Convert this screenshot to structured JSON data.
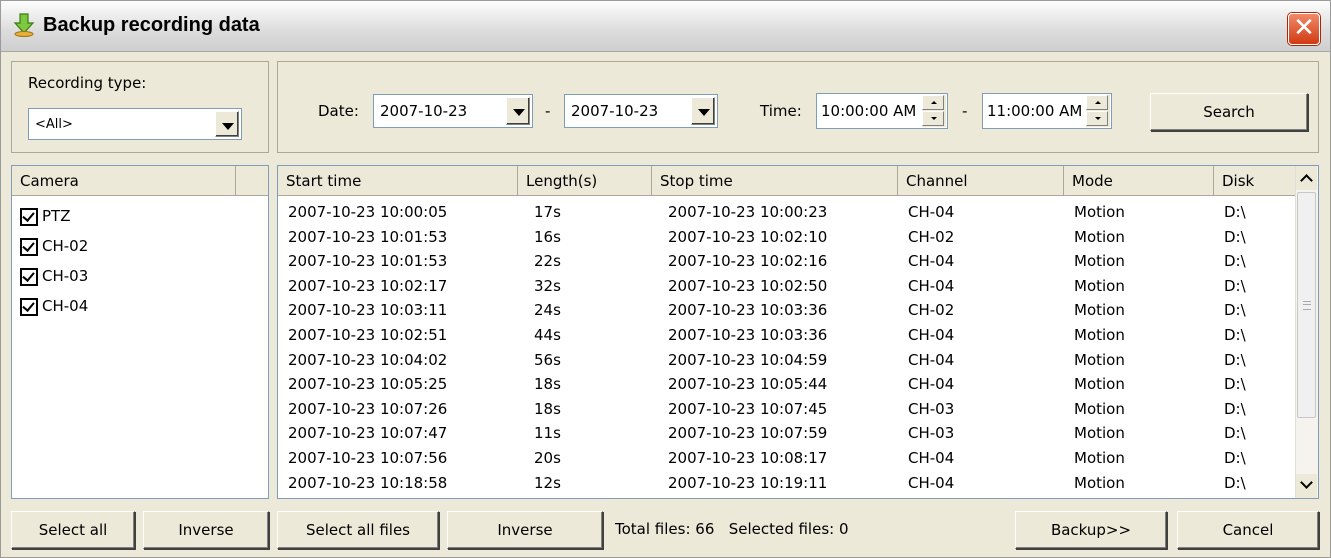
{
  "window": {
    "title": "Backup recording data",
    "close_glyph": "✕"
  },
  "filter": {
    "recording_type_label": "Recording type:",
    "recording_type_value": "<All>",
    "date_label": "Date:",
    "date_from": "2007-10-23",
    "date_sep": "-",
    "date_to": "2007-10-23",
    "time_label": "Time:",
    "time_from": "10:00:00 AM",
    "time_sep": "-",
    "time_to": "11:00:00 AM",
    "search_label": "Search"
  },
  "camera_list": {
    "header": "Camera",
    "items": [
      {
        "label": "PTZ",
        "checked": true
      },
      {
        "label": "CH-02",
        "checked": true
      },
      {
        "label": "CH-03",
        "checked": true
      },
      {
        "label": "CH-04",
        "checked": true
      }
    ]
  },
  "file_table": {
    "columns": [
      "Start time",
      "Length(s)",
      "Stop time",
      "Channel",
      "Mode",
      "Disk"
    ],
    "rows": [
      [
        "2007-10-23 10:00:05",
        "17s",
        "2007-10-23 10:00:23",
        "CH-04",
        "Motion",
        "D:\\"
      ],
      [
        "2007-10-23 10:01:53",
        "16s",
        "2007-10-23 10:02:10",
        "CH-02",
        "Motion",
        "D:\\"
      ],
      [
        "2007-10-23 10:01:53",
        "22s",
        "2007-10-23 10:02:16",
        "CH-04",
        "Motion",
        "D:\\"
      ],
      [
        "2007-10-23 10:02:17",
        "32s",
        "2007-10-23 10:02:50",
        "CH-04",
        "Motion",
        "D:\\"
      ],
      [
        "2007-10-23 10:03:11",
        "24s",
        "2007-10-23 10:03:36",
        "CH-02",
        "Motion",
        "D:\\"
      ],
      [
        "2007-10-23 10:02:51",
        "44s",
        "2007-10-23 10:03:36",
        "CH-04",
        "Motion",
        "D:\\"
      ],
      [
        "2007-10-23 10:04:02",
        "56s",
        "2007-10-23 10:04:59",
        "CH-04",
        "Motion",
        "D:\\"
      ],
      [
        "2007-10-23 10:05:25",
        "18s",
        "2007-10-23 10:05:44",
        "CH-04",
        "Motion",
        "D:\\"
      ],
      [
        "2007-10-23 10:07:26",
        "18s",
        "2007-10-23 10:07:45",
        "CH-03",
        "Motion",
        "D:\\"
      ],
      [
        "2007-10-23 10:07:47",
        "11s",
        "2007-10-23 10:07:59",
        "CH-03",
        "Motion",
        "D:\\"
      ],
      [
        "2007-10-23 10:07:56",
        "20s",
        "2007-10-23 10:08:17",
        "CH-04",
        "Motion",
        "D:\\"
      ],
      [
        "2007-10-23 10:18:58",
        "12s",
        "2007-10-23 10:19:11",
        "CH-04",
        "Motion",
        "D:\\"
      ]
    ]
  },
  "bottom": {
    "select_all": "Select all",
    "inverse_cameras": "Inverse",
    "select_all_files": "Select all files",
    "inverse_files": "Inverse",
    "total_files": "Total files: 66",
    "selected_files": "Selected files: 0",
    "backup": "Backup>>",
    "cancel": "Cancel"
  }
}
